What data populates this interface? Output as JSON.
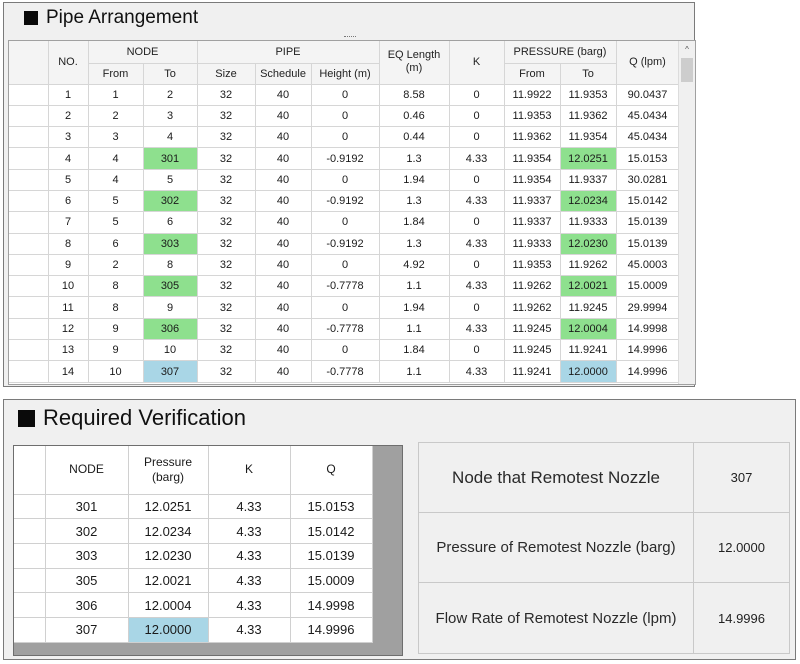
{
  "pipe_panel": {
    "title": "Pipe Arrangement",
    "headers": {
      "no": "NO.",
      "node": "NODE",
      "node_from": "From",
      "node_to": "To",
      "pipe": "PIPE",
      "size": "Size",
      "schedule": "Schedule",
      "height": "Height (m)",
      "eq_length": "EQ Length (m)",
      "k": "K",
      "pressure": "PRESSURE (barg)",
      "pressure_from": "From",
      "pressure_to": "To",
      "q": "Q (lpm)"
    },
    "scroll_up_glyph": "^",
    "rows": [
      {
        "no": "1",
        "from": "1",
        "to": "2",
        "size": "32",
        "schedule": "40",
        "height": "0",
        "eq": "8.58",
        "k": "0",
        "p_from": "11.9922",
        "p_to": "11.9353",
        "q": "90.0437",
        "to_hl": "",
        "pto_hl": ""
      },
      {
        "no": "2",
        "from": "2",
        "to": "3",
        "size": "32",
        "schedule": "40",
        "height": "0",
        "eq": "0.46",
        "k": "0",
        "p_from": "11.9353",
        "p_to": "11.9362",
        "q": "45.0434",
        "to_hl": "",
        "pto_hl": ""
      },
      {
        "no": "3",
        "from": "3",
        "to": "4",
        "size": "32",
        "schedule": "40",
        "height": "0",
        "eq": "0.44",
        "k": "0",
        "p_from": "11.9362",
        "p_to": "11.9354",
        "q": "45.0434",
        "to_hl": "",
        "pto_hl": ""
      },
      {
        "no": "4",
        "from": "4",
        "to": "301",
        "size": "32",
        "schedule": "40",
        "height": "-0.9192",
        "eq": "1.3",
        "k": "4.33",
        "p_from": "11.9354",
        "p_to": "12.0251",
        "q": "15.0153",
        "to_hl": "green",
        "pto_hl": "green"
      },
      {
        "no": "5",
        "from": "4",
        "to": "5",
        "size": "32",
        "schedule": "40",
        "height": "0",
        "eq": "1.94",
        "k": "0",
        "p_from": "11.9354",
        "p_to": "11.9337",
        "q": "30.0281",
        "to_hl": "",
        "pto_hl": ""
      },
      {
        "no": "6",
        "from": "5",
        "to": "302",
        "size": "32",
        "schedule": "40",
        "height": "-0.9192",
        "eq": "1.3",
        "k": "4.33",
        "p_from": "11.9337",
        "p_to": "12.0234",
        "q": "15.0142",
        "to_hl": "green",
        "pto_hl": "green"
      },
      {
        "no": "7",
        "from": "5",
        "to": "6",
        "size": "32",
        "schedule": "40",
        "height": "0",
        "eq": "1.84",
        "k": "0",
        "p_from": "11.9337",
        "p_to": "11.9333",
        "q": "15.0139",
        "to_hl": "",
        "pto_hl": ""
      },
      {
        "no": "8",
        "from": "6",
        "to": "303",
        "size": "32",
        "schedule": "40",
        "height": "-0.9192",
        "eq": "1.3",
        "k": "4.33",
        "p_from": "11.9333",
        "p_to": "12.0230",
        "q": "15.0139",
        "to_hl": "green",
        "pto_hl": "green"
      },
      {
        "no": "9",
        "from": "2",
        "to": "8",
        "size": "32",
        "schedule": "40",
        "height": "0",
        "eq": "4.92",
        "k": "0",
        "p_from": "11.9353",
        "p_to": "11.9262",
        "q": "45.0003",
        "to_hl": "",
        "pto_hl": ""
      },
      {
        "no": "10",
        "from": "8",
        "to": "305",
        "size": "32",
        "schedule": "40",
        "height": "-0.7778",
        "eq": "1.1",
        "k": "4.33",
        "p_from": "11.9262",
        "p_to": "12.0021",
        "q": "15.0009",
        "to_hl": "green",
        "pto_hl": "green"
      },
      {
        "no": "11",
        "from": "8",
        "to": "9",
        "size": "32",
        "schedule": "40",
        "height": "0",
        "eq": "1.94",
        "k": "0",
        "p_from": "11.9262",
        "p_to": "11.9245",
        "q": "29.9994",
        "to_hl": "",
        "pto_hl": ""
      },
      {
        "no": "12",
        "from": "9",
        "to": "306",
        "size": "32",
        "schedule": "40",
        "height": "-0.7778",
        "eq": "1.1",
        "k": "4.33",
        "p_from": "11.9245",
        "p_to": "12.0004",
        "q": "14.9998",
        "to_hl": "green",
        "pto_hl": "green"
      },
      {
        "no": "13",
        "from": "9",
        "to": "10",
        "size": "32",
        "schedule": "40",
        "height": "0",
        "eq": "1.84",
        "k": "0",
        "p_from": "11.9245",
        "p_to": "11.9241",
        "q": "14.9996",
        "to_hl": "",
        "pto_hl": ""
      },
      {
        "no": "14",
        "from": "10",
        "to": "307",
        "size": "32",
        "schedule": "40",
        "height": "-0.7778",
        "eq": "1.1",
        "k": "4.33",
        "p_from": "11.9241",
        "p_to": "12.0000",
        "q": "14.9996",
        "to_hl": "blue",
        "pto_hl": "blue"
      }
    ]
  },
  "verify_panel": {
    "title": "Required Verification",
    "headers": {
      "node": "NODE",
      "pressure_line1": "Pressure",
      "pressure_line2": "(barg)",
      "k": "K",
      "q": "Q"
    },
    "rows": [
      {
        "node": "301",
        "pressure": "12.0251",
        "k": "4.33",
        "q": "15.0153",
        "hl": ""
      },
      {
        "node": "302",
        "pressure": "12.0234",
        "k": "4.33",
        "q": "15.0142",
        "hl": ""
      },
      {
        "node": "303",
        "pressure": "12.0230",
        "k": "4.33",
        "q": "15.0139",
        "hl": ""
      },
      {
        "node": "305",
        "pressure": "12.0021",
        "k": "4.33",
        "q": "15.0009",
        "hl": ""
      },
      {
        "node": "306",
        "pressure": "12.0004",
        "k": "4.33",
        "q": "14.9998",
        "hl": ""
      },
      {
        "node": "307",
        "pressure": "12.0000",
        "k": "4.33",
        "q": "14.9996",
        "hl": "blue"
      }
    ],
    "summary": [
      {
        "label": "Node that Remotest Nozzle",
        "value": "307",
        "font_px": 17
      },
      {
        "label": "Pressure of Remotest Nozzle (barg)",
        "value": "12.0000",
        "font_px": 15
      },
      {
        "label": "Flow Rate of Remotest Nozzle (lpm)",
        "value": "14.9996",
        "font_px": 15
      }
    ]
  },
  "colors": {
    "highlight_green": "#8ee08e",
    "highlight_blue": "#a9d6e6",
    "panel_bg": "#f0f0f0"
  }
}
